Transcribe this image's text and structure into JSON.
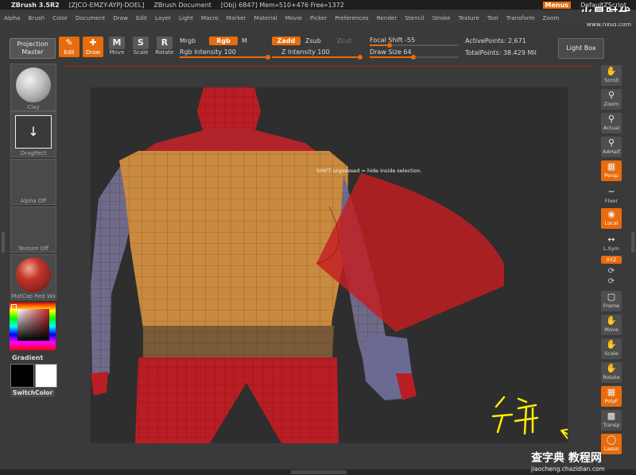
{
  "titlebar": {
    "app": "ZBrush 3.5R2",
    "code": "[ZJCO-EMZY-AYPJ-DOEL]",
    "doc": "ZBrush Document",
    "stats": "[Obj) 6847]  Mem»510+476  Free»1372",
    "menus": "Menus",
    "script": "DefaultZScript"
  },
  "watermark": {
    "brand": "火星时代",
    "url": "www.hxsd.com"
  },
  "menubar": [
    "Alpha",
    "Brush",
    "Color",
    "Document",
    "Draw",
    "Edit",
    "Layer",
    "Light",
    "Macro",
    "Marker",
    "Material",
    "Movie",
    "Picker",
    "Preferences",
    "Render",
    "Stencil",
    "Stroke",
    "Texture",
    "Tool",
    "Transform",
    "Zoom"
  ],
  "toolbar": {
    "projection": "Projection Master",
    "edit": "Edit",
    "draw": "Draw",
    "move": "Move",
    "scale": "Scale",
    "rotate": "Rotate",
    "mrgb": "Mrgb",
    "rgb": "Rgb",
    "m": "M",
    "zadd": "Zadd",
    "zsub": "Zsub",
    "zcut": "Zcut",
    "rgb_intensity": "Rgb Intensity 100",
    "z_intensity": "Z Intensity 100",
    "focal_shift": "Focal Shift -55",
    "draw_size": "Draw Size 64",
    "active_points": "ActivePoints: 2,671",
    "total_points": "TotalPoints: 38.429 Mil",
    "light_box": "Light Box",
    "rgb_intensity_value": 100,
    "z_intensity_value": 100,
    "focal_shift_value": -55,
    "draw_size_value": 64
  },
  "left": {
    "clay": "Clay",
    "dragrect": "DragRect",
    "alpha": "Alpha Off",
    "texture": "Texture Off",
    "matcap": "MatCap Red Wa",
    "gradient": "Gradient",
    "switchcolor": "SwitchColor"
  },
  "right": {
    "scroll": "Scroll",
    "zoom": "Zoom",
    "actual": "Actual",
    "aahalf": "AAHalf",
    "persp": "Persp",
    "floor": "Floor",
    "local": "Local",
    "lsym": "L.Sym",
    "xyz": "XYZ",
    "frame": "Frame",
    "move": "Move",
    "scale": "Scale",
    "rotate": "Rotate",
    "polyf": "PolyF",
    "transp": "Transp",
    "lasso": "Lasso"
  },
  "canvas": {
    "hint": "SHIFT unpressed = hide inside selection."
  },
  "bottom_watermark": {
    "brand": "查字典 教程网",
    "url": "jiaocheng.chazidian.com"
  },
  "colors": {
    "accent": "#e86b0c",
    "mesh_red": "#b81e24",
    "mesh_tan": "#c98a40",
    "selection": "#c41d21"
  }
}
